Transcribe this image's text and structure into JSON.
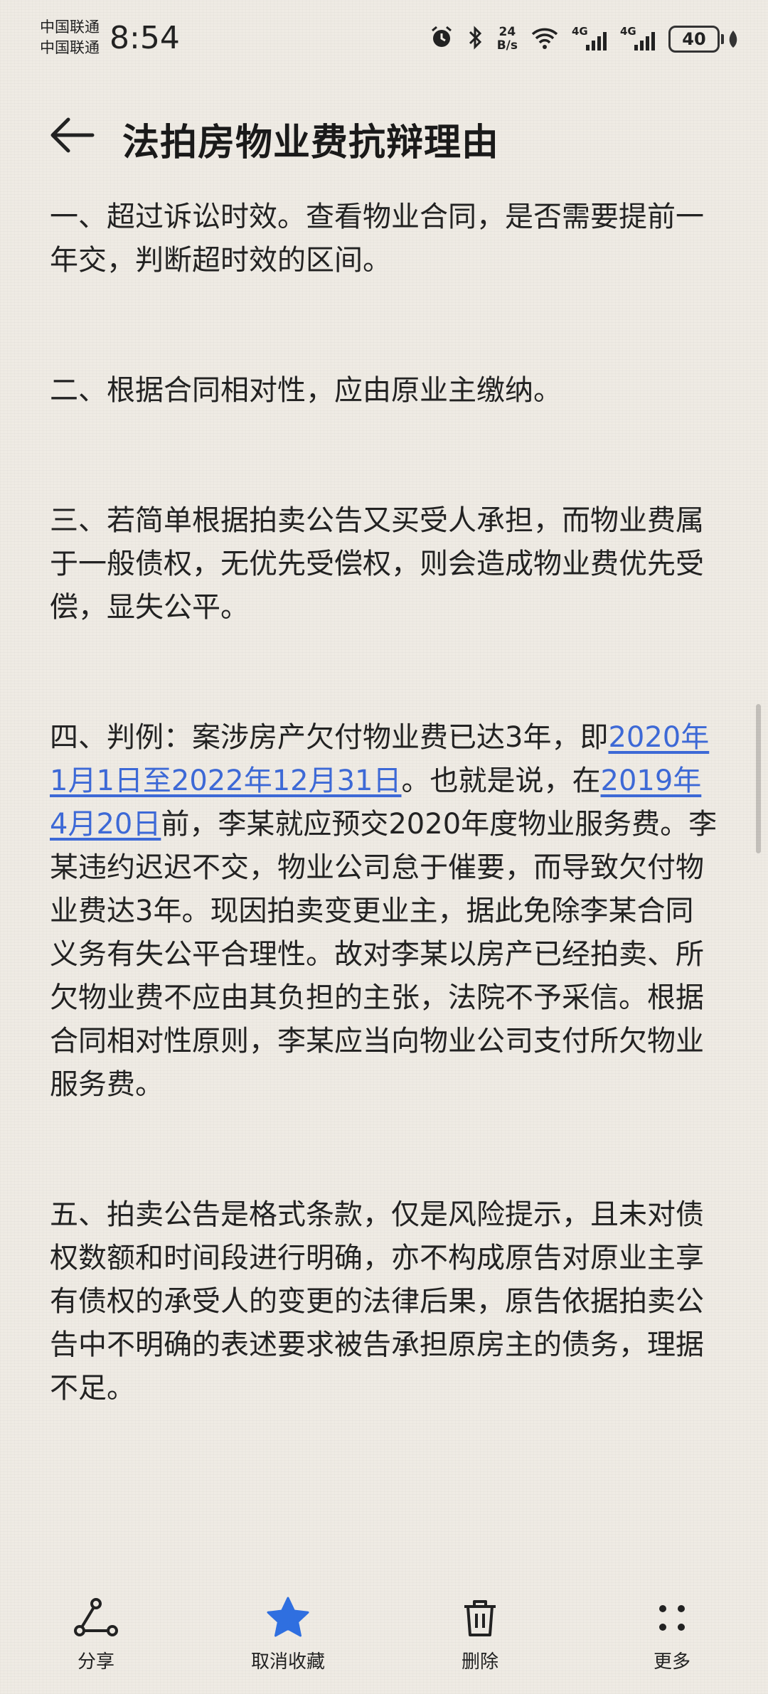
{
  "status_bar": {
    "carrier_1": "中国联通",
    "carrier_2": "中国联通",
    "time": "8:54",
    "net_speed_value": "24",
    "net_speed_unit": "B/s",
    "signal_1_label": "4G",
    "signal_2_label": "4G",
    "battery": "40"
  },
  "header": {
    "title": "法拍房物业费抗辩理由"
  },
  "content": {
    "p1": "一、超过诉讼时效。查看物业合同，是否需要提前一年交，判断超时效的区间。",
    "p2": "二、根据合同相对性，应由原业主缴纳。",
    "p3": "三、若简单根据拍卖公告又买受人承担，而物业费属于一般债权，无优先受偿权，则会造成物业费优先受偿，显失公平。",
    "p4": {
      "part1": "四、判例：案涉房产欠付物业费已达3年，即",
      "link1": "2020年1月1日至2022年12月31日",
      "part2": "。也就是说，在",
      "link2": "2019年4月20日",
      "part3": "前，李某就应预交2020年度物业服务费。李某违约迟迟不交，物业公司怠于催要，而导致欠付物业费达3年。现因拍卖变更业主，据此免除李某合同义务有失公平合理性。故对李某以房产已经拍卖、所欠物业费不应由其负担的主张，法院不予采信。根据合同相对性原则，李某应当向物业公司支付所欠物业服务费。"
    },
    "p5": "五、拍卖公告是格式条款，仅是风险提示，且未对债权数额和时间段进行明确，亦不构成原告对原业主享有债权的承受人的变更的法律后果，原告依据拍卖公告中不明确的表述要求被告承担原房主的债务，理据不足。"
  },
  "toolbar": {
    "share": "分享",
    "unfavorite": "取消收藏",
    "delete": "删除",
    "more": "更多"
  },
  "colors": {
    "link": "#3d69d6",
    "accent_star": "#2f6fe0"
  }
}
